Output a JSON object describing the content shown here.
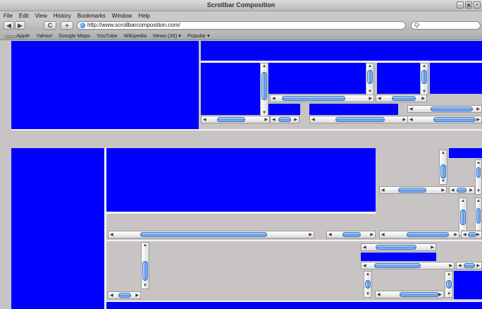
{
  "window": {
    "title": "Scrollbar Composition",
    "buttons": [
      "–",
      "▣",
      "✕"
    ]
  },
  "menu": [
    "File",
    "Edit",
    "View",
    "History",
    "Bookmarks",
    "Window",
    "Help"
  ],
  "toolbar": {
    "back_label": "◀",
    "forward_label": "▶",
    "reload_label": "C",
    "add_label": "+",
    "url": "http://www.scrollbarcomposition.com/",
    "search_placeholder": "Q-"
  },
  "bookmarks": {
    "items": [
      "Apple",
      "Yahoo!",
      "Google Maps",
      "YouTube",
      "Wikipedia",
      "News (26) ▾",
      "Popular ▾"
    ]
  },
  "colors": {
    "canvas_blue": "#0000ff",
    "panel_gray": "#c8c4c4",
    "thumb_blue": "#4f8fe6"
  }
}
